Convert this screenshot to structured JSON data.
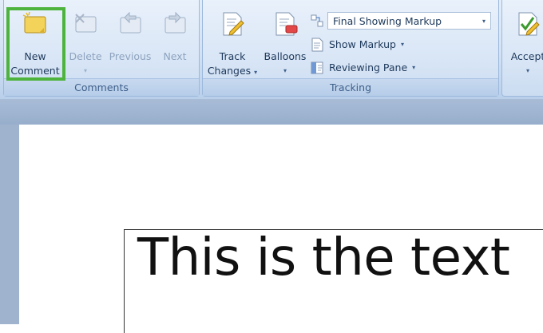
{
  "ribbon": {
    "comments_group": {
      "label": "Comments",
      "new_comment": {
        "line1": "New",
        "line2": "Comment"
      },
      "delete": {
        "label": "Delete",
        "arrow": "▾"
      },
      "previous": {
        "label": "Previous"
      },
      "next": {
        "label": "Next"
      }
    },
    "tracking_group": {
      "label": "Tracking",
      "track_changes": {
        "line1": "Track",
        "line2": "Changes",
        "arrow": "▾"
      },
      "balloons": {
        "label": "Balloons",
        "arrow": "▾"
      },
      "display_dropdown": {
        "value": "Final Showing Markup",
        "arrow": "▾"
      },
      "show_markup": {
        "label": "Show Markup",
        "arrow": "▾"
      },
      "reviewing_pane": {
        "label": "Reviewing Pane",
        "arrow": "▾"
      }
    },
    "changes_group": {
      "accept": {
        "label": "Accept",
        "arrow": "▾"
      }
    }
  },
  "document": {
    "text": "This is the text"
  },
  "colors": {
    "highlight": "#4db33d",
    "ribbon_bg": "#d2e1f4",
    "doc_bg": "#9fb3cf"
  }
}
